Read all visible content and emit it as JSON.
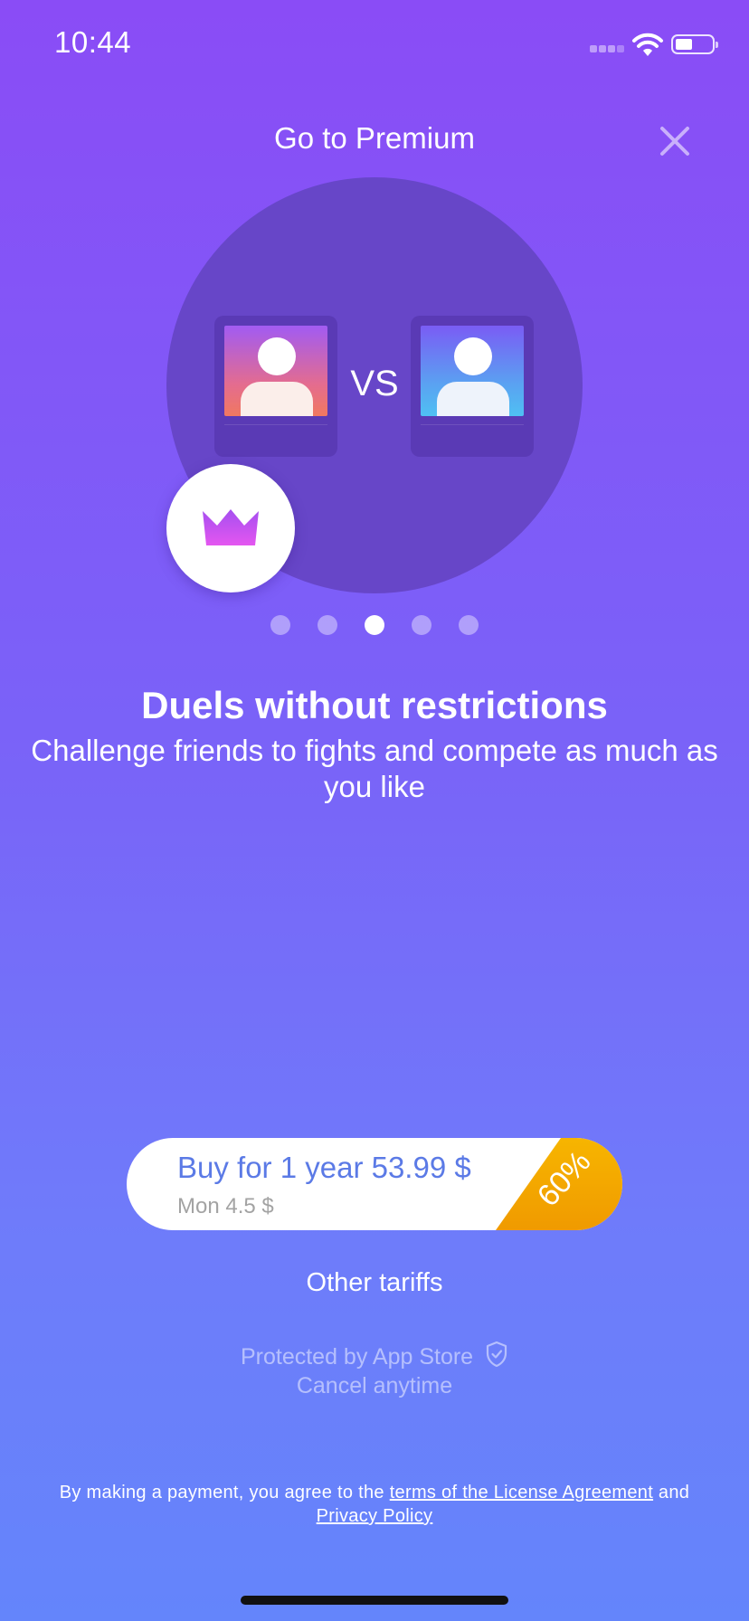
{
  "status_bar": {
    "time": "10:44"
  },
  "header": {
    "title": "Go to Premium",
    "close_icon": "close-icon"
  },
  "hero": {
    "vs_label": "VS",
    "badge_icon": "crown-icon"
  },
  "pager": {
    "count": 5,
    "active_index": 2
  },
  "feature": {
    "title": "Duels without restrictions",
    "description": "Challenge friends to fights and compete as much as you like"
  },
  "purchase": {
    "main_label": "Buy for 1 year 53.99 $",
    "sub_label": "Mon 4.5 $",
    "discount": "60%"
  },
  "other_tariffs_label": "Other tariffs",
  "trust": {
    "protected": "Protected by App Store",
    "cancel": "Cancel anytime"
  },
  "legal": {
    "prefix": "By making a payment, you agree to the ",
    "license_link": "terms of the License Agreement",
    "conjunction": " and",
    "privacy_link": "Privacy Policy"
  },
  "colors": {
    "background_top": "#8a4cf6",
    "background_bottom": "#6485fb",
    "button_text": "#5b7ae6",
    "discount": "#f5a900",
    "crown": "#c94df0"
  }
}
